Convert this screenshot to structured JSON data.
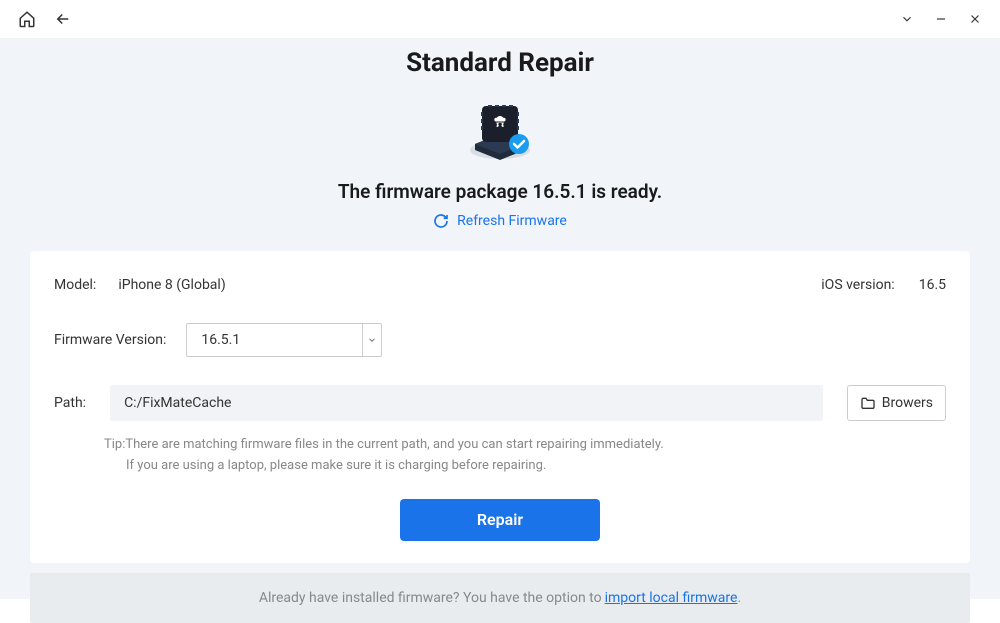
{
  "header": {
    "title": "Standard Repair",
    "ready_text": "The firmware package 16.5.1 is ready.",
    "refresh_label": "Refresh Firmware"
  },
  "info": {
    "model_label": "Model:",
    "model_value": "iPhone 8 (Global)",
    "ios_label": "iOS version:",
    "ios_value": "16.5",
    "fw_label": "Firmware Version:",
    "fw_value": "16.5.1",
    "path_label": "Path:",
    "path_value": "C:/FixMateCache",
    "browse_label": "Browers"
  },
  "tip": {
    "prefix": "Tip:",
    "line1": "There are matching firmware files in the current path, and you can start repairing immediately.",
    "line2": "If you are using a laptop, please make sure it is charging before repairing."
  },
  "actions": {
    "repair_label": "Repair"
  },
  "footer": {
    "text": "Already have installed firmware? You have the option to ",
    "link": "import local firmware",
    "period": "."
  }
}
